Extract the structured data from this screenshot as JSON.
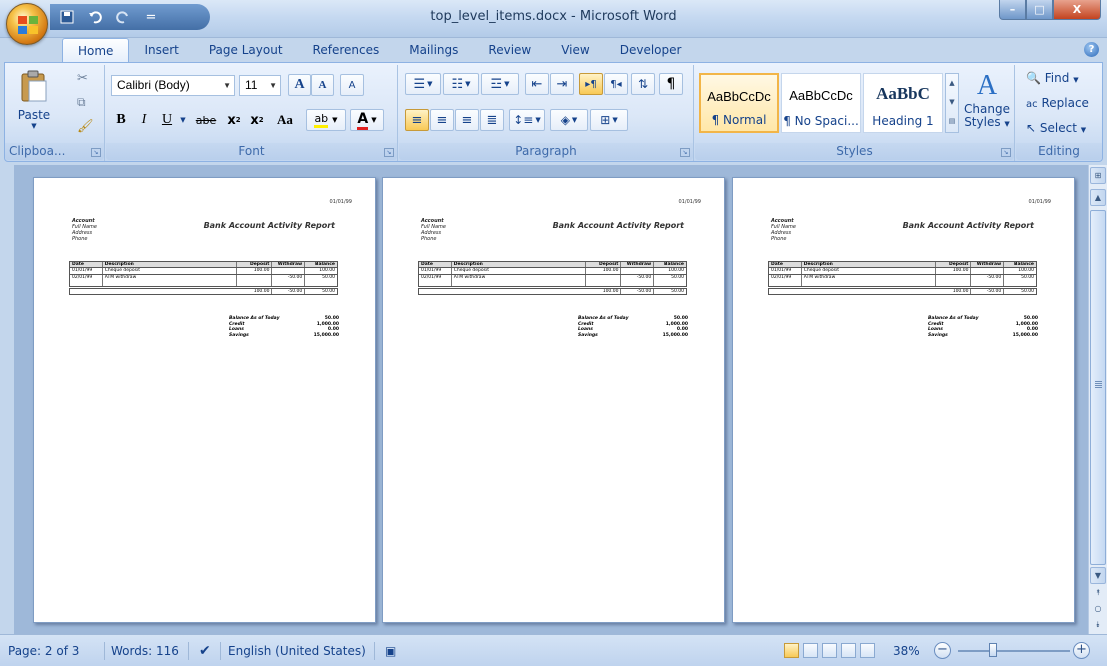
{
  "window": {
    "title": "top_level_items.docx - Microsoft Word",
    "controls": {
      "minimize": "–",
      "maximize": "□",
      "close": "X"
    }
  },
  "qat": {
    "save_icon": "save-icon",
    "undo_icon": "undo-icon",
    "redo_icon": "redo-icon",
    "customize": "="
  },
  "tabs": [
    {
      "label": "Home",
      "active": true
    },
    {
      "label": "Insert"
    },
    {
      "label": "Page Layout"
    },
    {
      "label": "References"
    },
    {
      "label": "Mailings"
    },
    {
      "label": "Review"
    },
    {
      "label": "View"
    },
    {
      "label": "Developer"
    }
  ],
  "help": "?",
  "ribbon": {
    "clipboard": {
      "label": "Clipboa...",
      "paste": "Paste"
    },
    "font": {
      "label": "Font",
      "name": "Calibri (Body)",
      "size": "11",
      "grow": "A",
      "shrink": "A",
      "clear": "A",
      "bold": "B",
      "italic": "I",
      "underline": "U",
      "strike": "abe",
      "subscript": "x",
      "superscript": "x",
      "change_case": "Aa",
      "highlight": "ab",
      "font_color": "A"
    },
    "paragraph": {
      "label": "Paragraph",
      "pilcrow": "¶"
    },
    "styles": {
      "label": "Styles",
      "items": [
        {
          "sample": "AaBbCcDc",
          "name": "¶ Normal",
          "selected": true
        },
        {
          "sample": "AaBbCcDc",
          "name": "¶ No Spaci..."
        },
        {
          "sample": "AaBbC",
          "name": "Heading 1"
        }
      ],
      "change_styles_line1": "Change",
      "change_styles_line2": "Styles"
    },
    "editing": {
      "label": "Editing",
      "find": "Find",
      "replace": "Replace",
      "select": "Select"
    }
  },
  "pages": [
    {
      "date": "01/01/99",
      "labels": [
        "Account",
        "Full Name",
        "Address",
        "Phone"
      ],
      "title": "Bank Account Activity Report",
      "headers": [
        "Date",
        "Description",
        "Deposit",
        "Withdraw",
        "Balance"
      ],
      "rows": [
        [
          "01/01/99",
          "Cheque deposit",
          "100.00",
          "",
          "100.00"
        ],
        [
          "02/01/99",
          "ATM withdraw",
          "",
          "-50.00",
          "50.00"
        ]
      ],
      "totals": [
        "",
        "",
        "100.00",
        "-50.00",
        "50.00"
      ],
      "summary": [
        [
          "Balance As of Today",
          "50.00"
        ],
        [
          "Credit",
          "1,000.00"
        ],
        [
          "Loans",
          "0.00"
        ],
        [
          "Savings",
          "15,000.00"
        ]
      ]
    },
    {
      "date": "01/01/99",
      "labels": [
        "Account",
        "Full Name",
        "Address",
        "Phone"
      ],
      "title": "Bank Account Activity Report",
      "headers": [
        "Date",
        "Description",
        "Deposit",
        "Withdraw",
        "Balance"
      ],
      "rows": [
        [
          "01/01/99",
          "Cheque deposit",
          "100.00",
          "",
          "100.00"
        ],
        [
          "02/01/99",
          "ATM withdraw",
          "",
          "-50.00",
          "50.00"
        ]
      ],
      "totals": [
        "",
        "",
        "100.00",
        "-50.00",
        "50.00"
      ],
      "summary": [
        [
          "Balance As of Today",
          "50.00"
        ],
        [
          "Credit",
          "1,000.00"
        ],
        [
          "Loans",
          "0.00"
        ],
        [
          "Savings",
          "15,000.00"
        ]
      ]
    },
    {
      "date": "01/01/99",
      "labels": [
        "Account",
        "Full Name",
        "Address",
        "Phone"
      ],
      "title": "Bank Account Activity Report",
      "headers": [
        "Date",
        "Description",
        "Deposit",
        "Withdraw",
        "Balance"
      ],
      "rows": [
        [
          "01/01/99",
          "Cheque deposit",
          "100.00",
          "",
          "100.00"
        ],
        [
          "02/01/99",
          "ATM withdraw",
          "",
          "-50.00",
          "50.00"
        ]
      ],
      "totals": [
        "",
        "",
        "100.00",
        "-50.00",
        "50.00"
      ],
      "summary": [
        [
          "Balance As of Today",
          "50.00"
        ],
        [
          "Credit",
          "1,000.00"
        ],
        [
          "Loans",
          "0.00"
        ],
        [
          "Savings",
          "15,000.00"
        ]
      ]
    }
  ],
  "status": {
    "page": "Page: 2 of 3",
    "words": "Words: 116",
    "language": "English (United States)",
    "zoom": "38%",
    "zoom_level": 0.38,
    "zoom_out": "−",
    "zoom_in": "+"
  },
  "colors": {
    "accent": "#15428b",
    "ribbon": "#dbe7f7",
    "workspace": "#9eb8d9",
    "selected_style": "#f2b548"
  }
}
